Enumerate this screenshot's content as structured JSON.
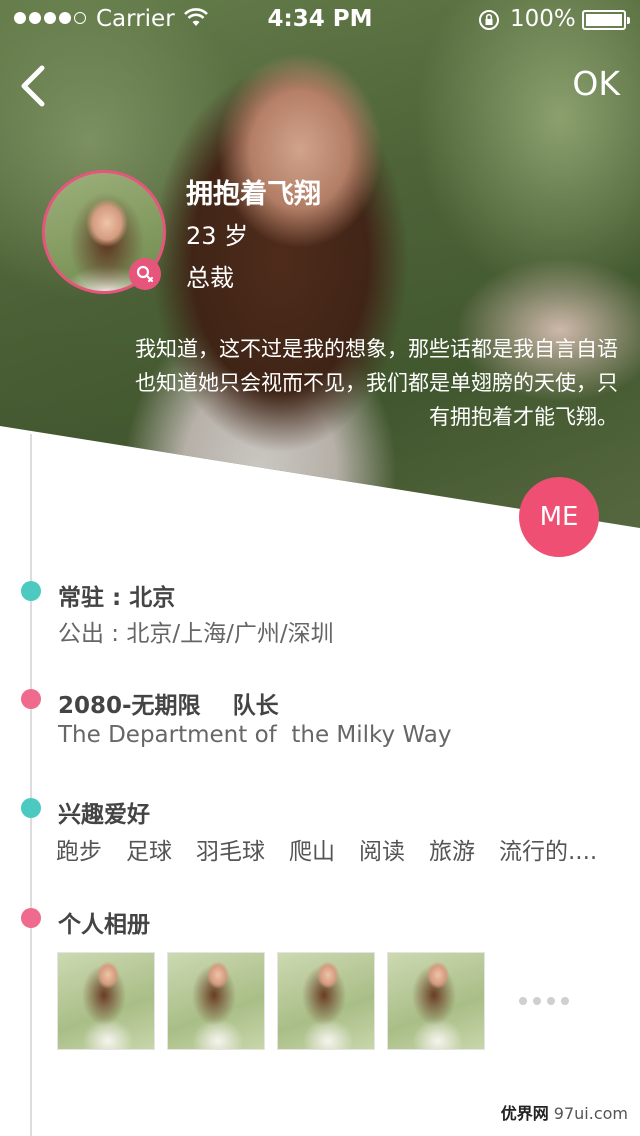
{
  "status_bar": {
    "carrier": "Carrier",
    "time": "4:34 PM",
    "battery": "100%"
  },
  "nav": {
    "ok_label": "OK"
  },
  "profile": {
    "name": "拥抱着飞翔",
    "age": "23 岁",
    "title": "总裁",
    "bio_lines": [
      "我知道，这不过是我的想象，那些话都是我自言自语",
      "也知道她只会视而不见，我们都是单翅膀的天使，只",
      "有拥抱着才能飞翔。"
    ],
    "me_badge": "ME",
    "gender_icon": "female-icon"
  },
  "sections": {
    "residence": {
      "title": "常驻 : 北京",
      "subtitle": "公出 : 北京/上海/广州/深圳"
    },
    "career": {
      "title": "2080-无期限    队长",
      "subtitle": "The Department of  the Milky Way"
    },
    "hobbies": {
      "title": "兴趣爱好",
      "items": [
        "跑步",
        "足球",
        "羽毛球",
        "爬山",
        "阅读",
        "旅游",
        "流行的...."
      ]
    },
    "album": {
      "title": "个人相册",
      "photo_count_shown": 4
    }
  },
  "watermark": {
    "brand": "优界网",
    "domain": "97ui.com"
  },
  "colors": {
    "accent_pink": "#ee4f73",
    "dot_teal": "#4cc9c0",
    "dot_pink": "#ef6a8c"
  }
}
